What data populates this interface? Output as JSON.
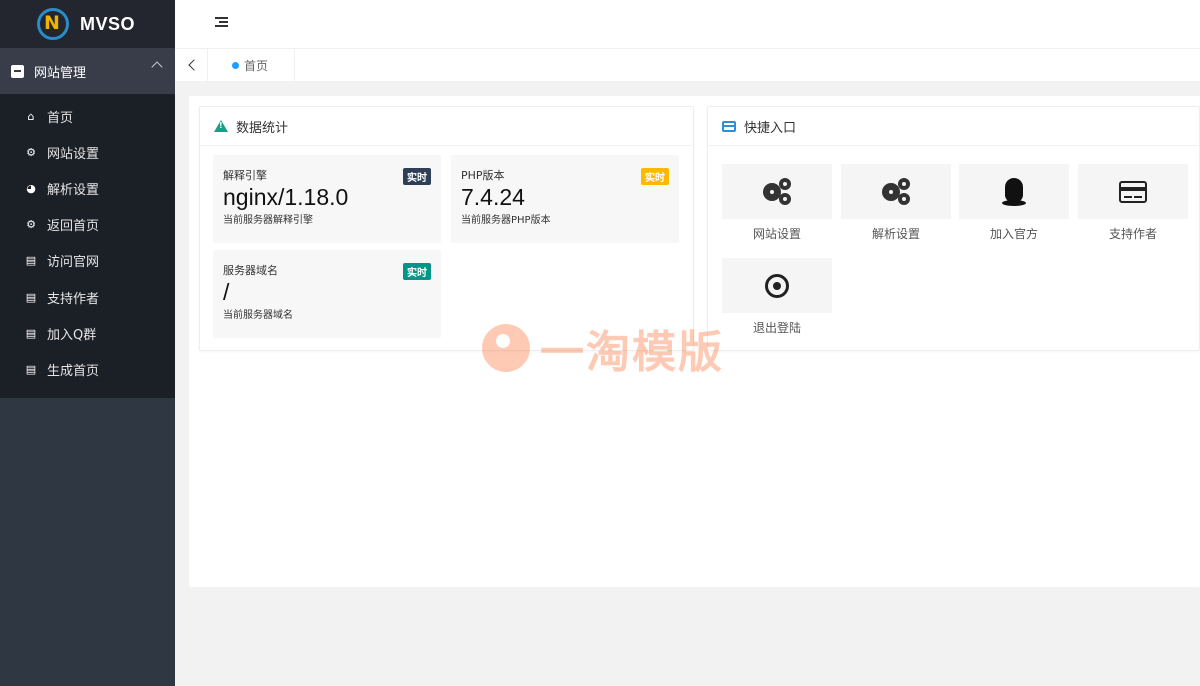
{
  "brand": {
    "name": "MVSO",
    "accent": "#2a8cc9"
  },
  "sidebar": {
    "group_label": "网站管理",
    "items": [
      {
        "label": "首页",
        "icon": "home-icon",
        "glyph": "⌂"
      },
      {
        "label": "网站设置",
        "icon": "settings-icon",
        "glyph": "⚙"
      },
      {
        "label": "解析设置",
        "icon": "dashboard-icon",
        "glyph": "◕"
      },
      {
        "label": "返回首页",
        "icon": "cogs-icon",
        "glyph": "⚙"
      },
      {
        "label": "访问官网",
        "icon": "file-icon",
        "glyph": "▤"
      },
      {
        "label": "支持作者",
        "icon": "file-icon",
        "glyph": "▤"
      },
      {
        "label": "加入Q群",
        "icon": "file-icon",
        "glyph": "▤"
      },
      {
        "label": "生成首页",
        "icon": "file-icon",
        "glyph": "▤"
      }
    ]
  },
  "tabs": {
    "home": "首页"
  },
  "stats_card": {
    "title": "数据统计",
    "items": [
      {
        "label": "解释引擎",
        "badge": "实时",
        "badge_color": "#2f4056",
        "value": "nginx/1.18.0",
        "desc": "当前服务器解释引擎"
      },
      {
        "label": "PHP版本",
        "badge": "实时",
        "badge_color": "#ffb800",
        "value": "7.4.24",
        "desc": "当前服务器PHP版本"
      },
      {
        "label": "服务器域名",
        "badge": "实时",
        "badge_color": "#009688",
        "value": "/",
        "desc": "当前服务器域名"
      }
    ]
  },
  "quick_card": {
    "title": "快捷入口",
    "items": [
      {
        "label": "网站设置",
        "icon": "gears-icon"
      },
      {
        "label": "解析设置",
        "icon": "gears-icon"
      },
      {
        "label": "加入官方",
        "icon": "qq-penguin-icon"
      },
      {
        "label": "支持作者",
        "icon": "credit-card-icon"
      },
      {
        "label": "退出登陆",
        "icon": "dot-circle-icon"
      }
    ]
  },
  "watermark": {
    "text": "一淘模版"
  }
}
